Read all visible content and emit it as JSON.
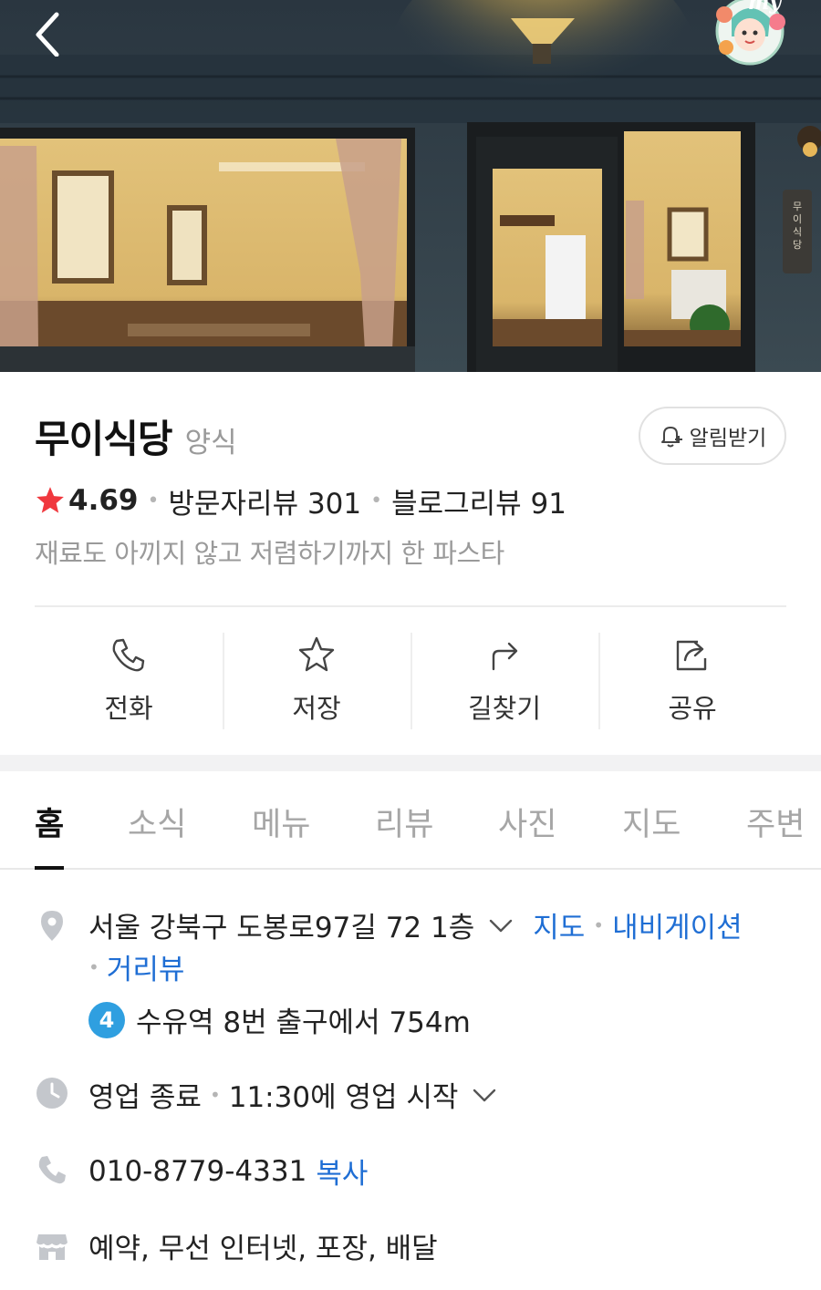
{
  "hero": {
    "door_sign": "무이식당",
    "avatar_text": "my"
  },
  "place": {
    "name": "무이식당",
    "category": "양식",
    "notify_label": "알림받기",
    "rating": "4.69",
    "visitor_reviews": "방문자리뷰 301",
    "blog_reviews": "블로그리뷰 91",
    "description": "재료도 아끼지 않고 저렴하기까지 한 파스타"
  },
  "actions": [
    {
      "label": "전화",
      "icon": "phone-icon"
    },
    {
      "label": "저장",
      "icon": "star-outline-icon"
    },
    {
      "label": "길찾기",
      "icon": "directions-arrow-icon"
    },
    {
      "label": "공유",
      "icon": "share-icon"
    }
  ],
  "tabs": [
    "홈",
    "소식",
    "메뉴",
    "리뷰",
    "사진",
    "지도",
    "주변"
  ],
  "active_tab": "홈",
  "address": {
    "text": "서울 강북구 도봉로97길 72 1층",
    "map_link": "지도",
    "navigation_link": "내비게이션",
    "streetview_link": "거리뷰"
  },
  "subway": {
    "line": "4",
    "line_color": "#2f9fe0",
    "text": "수유역 8번 출구에서 754m"
  },
  "hours": {
    "status": "영업 종료",
    "next": "11:30에 영업 시작"
  },
  "phone": {
    "number": "010-8779-4331",
    "copy_label": "복사"
  },
  "amenities": {
    "text": "예약, 무선 인터넷, 포장, 배달"
  },
  "colors": {
    "link": "#1f6ed4",
    "star": "#f0383e",
    "icon_gray": "#c4c7cc"
  }
}
